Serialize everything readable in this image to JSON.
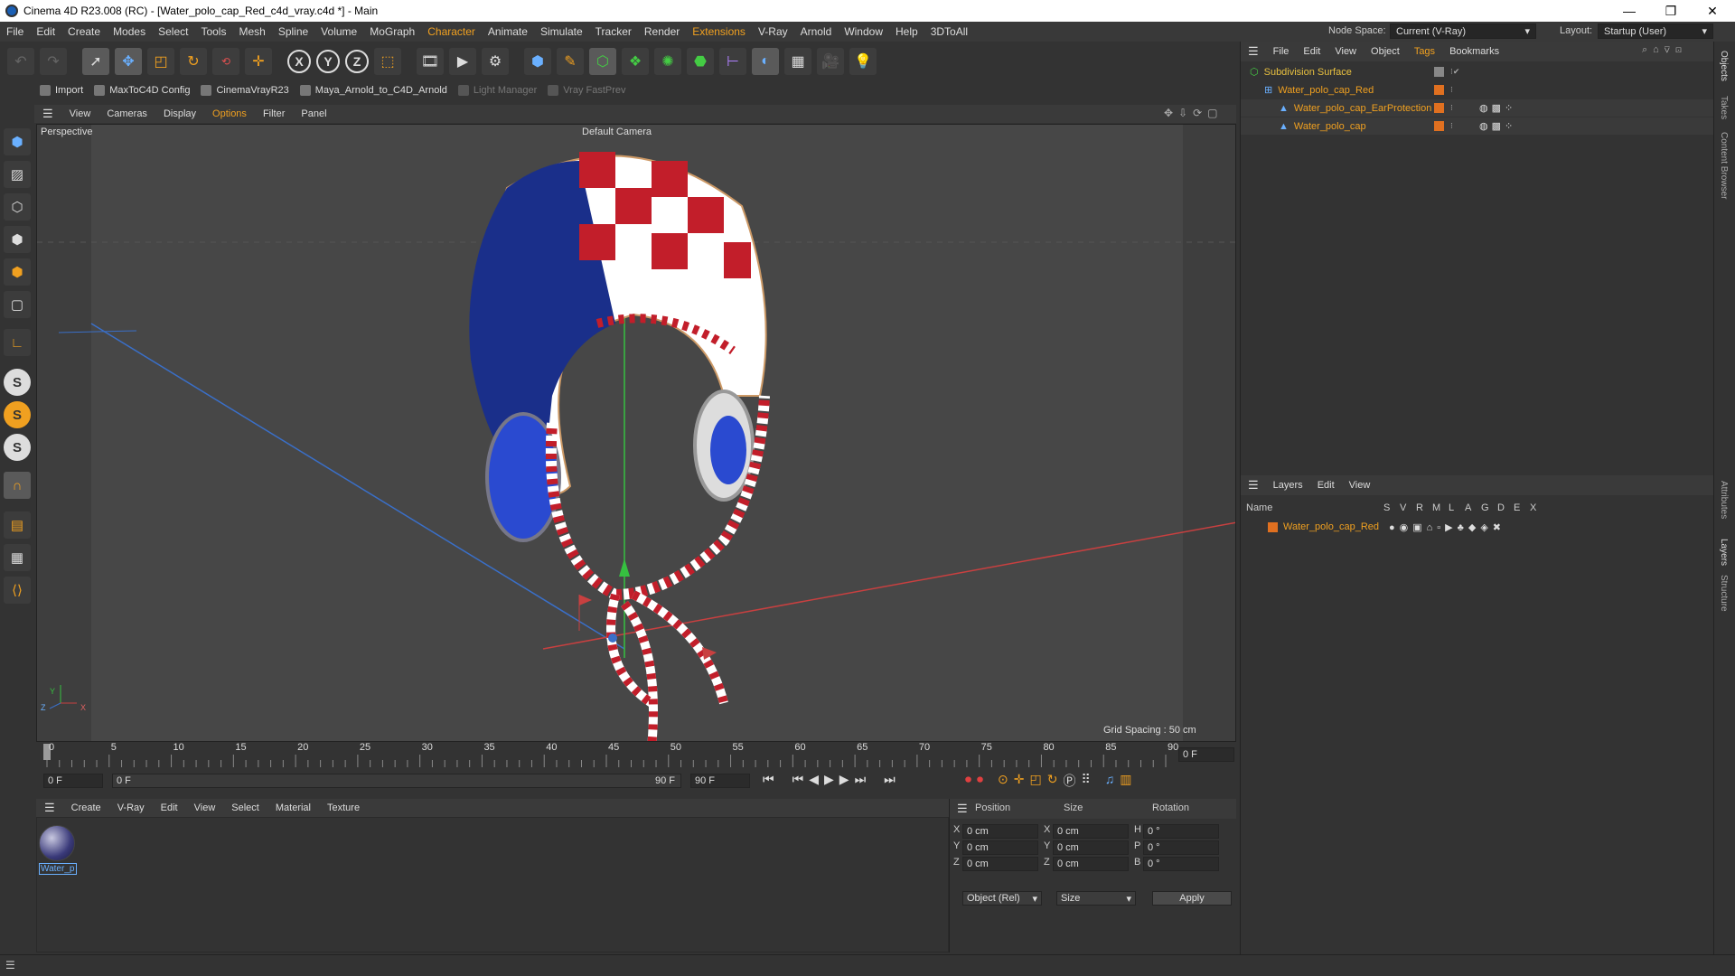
{
  "window": {
    "title": "Cinema 4D R23.008 (RC) - [Water_polo_cap_Red_c4d_vray.c4d *] - Main",
    "min": "—",
    "max": "❐",
    "close": "✕"
  },
  "menubar": {
    "items": [
      "File",
      "Edit",
      "Create",
      "Modes",
      "Select",
      "Tools",
      "Mesh",
      "Spline",
      "Volume",
      "MoGraph",
      "Character",
      "Animate",
      "Simulate",
      "Tracker",
      "Render",
      "Extensions",
      "V-Ray",
      "Arnold",
      "Window",
      "Help",
      "3DToAll"
    ],
    "highlight": [
      "Character",
      "Extensions"
    ],
    "node_space_label": "Node Space:",
    "node_space_value": "Current (V-Ray)",
    "layout_label": "Layout:",
    "layout_value": "Startup (User)"
  },
  "plugins": {
    "items": [
      {
        "label": "Import",
        "enabled": true
      },
      {
        "label": "MaxToC4D Config",
        "enabled": true
      },
      {
        "label": "CinemaVrayR23",
        "enabled": true
      },
      {
        "label": "Maya_Arnold_to_C4D_Arnold",
        "enabled": true
      },
      {
        "label": "Light Manager",
        "enabled": false
      },
      {
        "label": "Vray FastPrev",
        "enabled": false
      }
    ]
  },
  "viewport": {
    "menu": [
      "View",
      "Cameras",
      "Display",
      "Options",
      "Filter",
      "Panel"
    ],
    "menu_highlight": "Options",
    "label": "Perspective",
    "camera": "Default Camera",
    "grid_spacing": "Grid Spacing : 50 cm"
  },
  "timeline": {
    "ticks": [
      "0",
      "5",
      "10",
      "15",
      "20",
      "25",
      "30",
      "35",
      "40",
      "45",
      "50",
      "55",
      "60",
      "65",
      "70",
      "75",
      "80",
      "85",
      "90"
    ],
    "current_frame": "0 F",
    "start": "0 F",
    "range_start": "0 F",
    "range_end": "90 F",
    "end": "90 F"
  },
  "material": {
    "menu": [
      "Create",
      "V-Ray",
      "Edit",
      "View",
      "Select",
      "Material",
      "Texture"
    ],
    "items": [
      {
        "label": "Water_p"
      }
    ]
  },
  "coords": {
    "headers": [
      "Position",
      "Size",
      "Rotation"
    ],
    "rows": [
      {
        "axis": "X",
        "pos": "0 cm",
        "size_axis": "X",
        "size": "0 cm",
        "rot_axis": "H",
        "rot": "0 °"
      },
      {
        "axis": "Y",
        "pos": "0 cm",
        "size_axis": "Y",
        "size": "0 cm",
        "rot_axis": "P",
        "rot": "0 °"
      },
      {
        "axis": "Z",
        "pos": "0 cm",
        "size_axis": "Z",
        "size": "0 cm",
        "rot_axis": "B",
        "rot": "0 °"
      }
    ],
    "mode": "Object (Rel)",
    "size_mode": "Size",
    "apply": "Apply"
  },
  "objects": {
    "menu": [
      "File",
      "Edit",
      "View",
      "Object",
      "Tags",
      "Bookmarks"
    ],
    "menu_highlight": "Tags",
    "items": [
      {
        "name": "Subdivision Surface",
        "indent": 0,
        "color": "#e8c040"
      },
      {
        "name": "Water_polo_cap_Red",
        "indent": 1,
        "color": "#f0a020"
      },
      {
        "name": "Water_polo_cap_EarProtection",
        "indent": 2,
        "color": "#f0a020"
      },
      {
        "name": "Water_polo_cap",
        "indent": 2,
        "color": "#f0a020"
      }
    ]
  },
  "layers": {
    "menu": [
      "Layers",
      "Edit",
      "View"
    ],
    "columns": [
      "Name",
      "S",
      "V",
      "R",
      "M",
      "L",
      "A",
      "G",
      "D",
      "E",
      "X"
    ],
    "items": [
      {
        "name": "Water_polo_cap_Red",
        "color": "#e07020"
      }
    ]
  },
  "side_tabs": [
    "Objects",
    "Takes",
    "Content Browser",
    "Attributes",
    "Layers",
    "Structure"
  ],
  "colors": {
    "accent": "#f0a020",
    "background": "#333333",
    "viewport": "#474747"
  }
}
